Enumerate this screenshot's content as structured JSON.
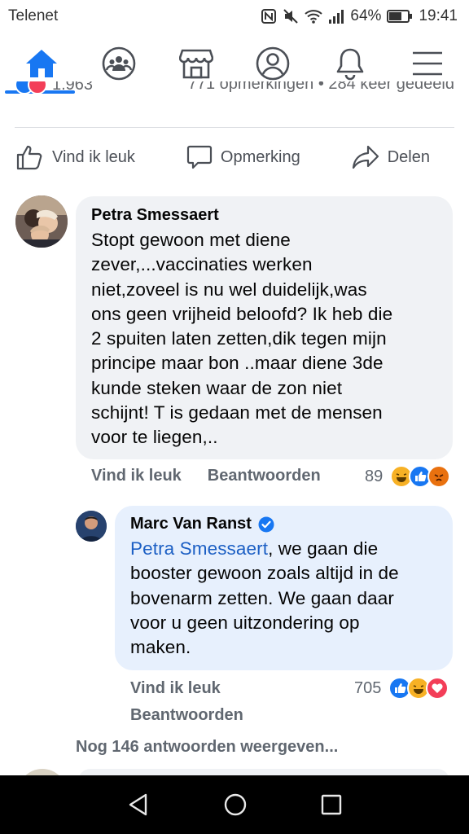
{
  "status_bar": {
    "carrier": "Telenet",
    "battery": "64%",
    "time": "19:41"
  },
  "nav": {
    "items": [
      "home",
      "groups",
      "marketplace",
      "profile",
      "notifications",
      "menu"
    ],
    "active": "home"
  },
  "post_summary": {
    "reaction_count": "1.963",
    "comments_shares": "771 opmerkingen • 284 keer gedeeld"
  },
  "actions": {
    "like": "Vind ik leuk",
    "comment": "Opmerking",
    "share": "Delen"
  },
  "comment1": {
    "author": "Petra Smessaert",
    "lines": [
      "Stopt gewoon met diene",
      "zever,...vaccinaties werken",
      "niet,zoveel is nu wel duidelijk,was",
      "ons geen vrijheid beloofd? Ik heb die",
      "2 spuiten laten zetten,dik tegen mijn",
      "principe maar bon ..maar diene 3de",
      "kunde steken waar de zon niet",
      "schijnt! T is gedaan met de mensen",
      "voor te liegen,.."
    ],
    "like_label": "Vind ik leuk",
    "reply_label": "Beantwoorden",
    "reaction_count": "89"
  },
  "reply1": {
    "author": "Marc Van Ranst",
    "verified": true,
    "mention": "Petra Smessaert",
    "first_line_rest": ", we gaan die",
    "lines": [
      "booster gewoon zoals altijd in de",
      "bovenarm zetten. We gaan daar",
      "voor u geen uitzondering op",
      "maken."
    ],
    "like_label": "Vind ik leuk",
    "reply_label": "Beantwoorden",
    "reaction_count": "705"
  },
  "more_replies": "Nog 146 antwoorden weergeven...",
  "colors": {
    "brand": "#1877f2",
    "bubble": "#f0f2f5",
    "highlight_bubble": "#e7f0fd",
    "love": "#f33e58",
    "haha": "#f7b125",
    "angry": "#e9710f"
  }
}
